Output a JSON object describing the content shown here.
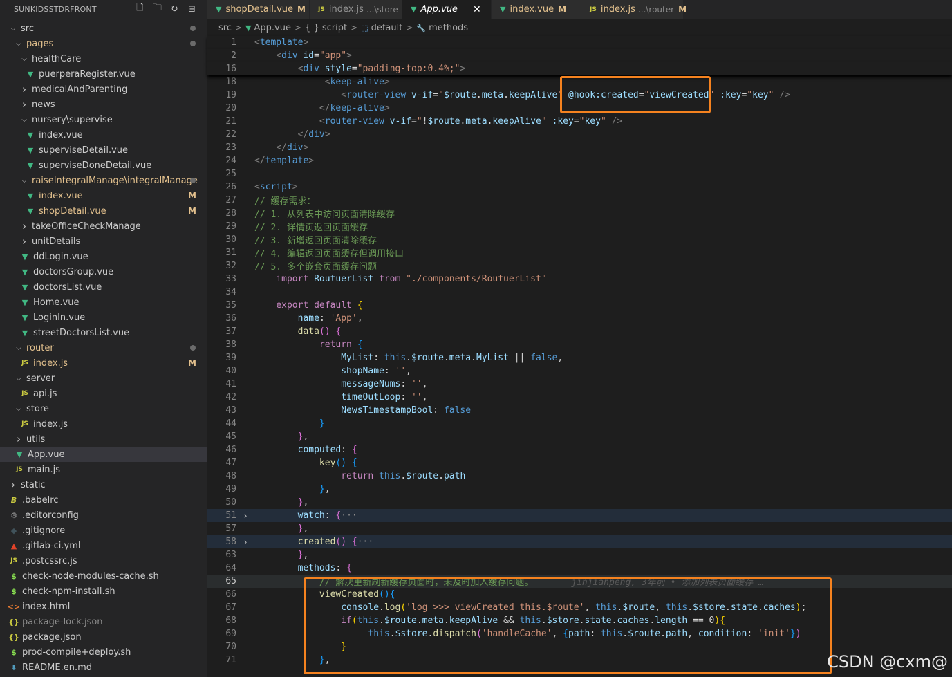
{
  "sidebar": {
    "title": "SUNKIDSSTDRFRONT",
    "actions": [
      "new-file-icon",
      "new-folder-icon",
      "refresh-icon",
      "collapse-all-icon"
    ],
    "items": [
      {
        "label": "src",
        "indent": 0,
        "type": "folder-open",
        "status": "dot"
      },
      {
        "label": "pages",
        "indent": 1,
        "type": "folder-open",
        "status": "dot",
        "color": "mod"
      },
      {
        "label": "healthCare",
        "indent": 2,
        "type": "folder-open"
      },
      {
        "label": "puerperaRegister.vue",
        "indent": 3,
        "type": "vue"
      },
      {
        "label": "medicalAndParenting",
        "indent": 2,
        "type": "folder-closed"
      },
      {
        "label": "news",
        "indent": 2,
        "type": "folder-closed"
      },
      {
        "label": "nursery\\supervise",
        "indent": 2,
        "type": "folder-open"
      },
      {
        "label": "index.vue",
        "indent": 3,
        "type": "vue"
      },
      {
        "label": "superviseDetail.vue",
        "indent": 3,
        "type": "vue"
      },
      {
        "label": "superviseDoneDetail.vue",
        "indent": 3,
        "type": "vue"
      },
      {
        "label": "raiseIntegralManage\\integralManage",
        "indent": 2,
        "type": "folder-open",
        "status": "dot",
        "color": "mod"
      },
      {
        "label": "index.vue",
        "indent": 3,
        "type": "vue",
        "status": "M",
        "color": "mod"
      },
      {
        "label": "shopDetail.vue",
        "indent": 3,
        "type": "vue",
        "status": "M",
        "color": "mod"
      },
      {
        "label": "takeOfficeCheckManage",
        "indent": 2,
        "type": "folder-closed"
      },
      {
        "label": "unitDetails",
        "indent": 2,
        "type": "folder-closed"
      },
      {
        "label": "ddLogin.vue",
        "indent": 2,
        "type": "vue"
      },
      {
        "label": "doctorsGroup.vue",
        "indent": 2,
        "type": "vue"
      },
      {
        "label": "doctorsList.vue",
        "indent": 2,
        "type": "vue"
      },
      {
        "label": "Home.vue",
        "indent": 2,
        "type": "vue"
      },
      {
        "label": "LoginIn.vue",
        "indent": 2,
        "type": "vue"
      },
      {
        "label": "streetDoctorsList.vue",
        "indent": 2,
        "type": "vue"
      },
      {
        "label": "router",
        "indent": 1,
        "type": "folder-open",
        "status": "dot",
        "color": "mod"
      },
      {
        "label": "index.js",
        "indent": 2,
        "type": "js",
        "status": "M",
        "color": "mod"
      },
      {
        "label": "server",
        "indent": 1,
        "type": "folder-open"
      },
      {
        "label": "api.js",
        "indent": 2,
        "type": "js"
      },
      {
        "label": "store",
        "indent": 1,
        "type": "folder-open"
      },
      {
        "label": "index.js",
        "indent": 2,
        "type": "js"
      },
      {
        "label": "utils",
        "indent": 1,
        "type": "folder-closed"
      },
      {
        "label": "App.vue",
        "indent": 1,
        "type": "vue",
        "active": true
      },
      {
        "label": "main.js",
        "indent": 1,
        "type": "js"
      },
      {
        "label": "static",
        "indent": 0,
        "type": "folder-closed"
      },
      {
        "label": ".babelrc",
        "indent": 0,
        "type": "babel"
      },
      {
        "label": ".editorconfig",
        "indent": 0,
        "type": "gear"
      },
      {
        "label": ".gitignore",
        "indent": 0,
        "type": "git"
      },
      {
        "label": ".gitlab-ci.yml",
        "indent": 0,
        "type": "gitlab"
      },
      {
        "label": ".postcssrc.js",
        "indent": 0,
        "type": "js"
      },
      {
        "label": "check-node-modules-cache.sh",
        "indent": 0,
        "type": "sh"
      },
      {
        "label": "check-npm-install.sh",
        "indent": 0,
        "type": "sh"
      },
      {
        "label": "index.html",
        "indent": 0,
        "type": "html"
      },
      {
        "label": "package-lock.json",
        "indent": 0,
        "type": "json",
        "color": "dim"
      },
      {
        "label": "package.json",
        "indent": 0,
        "type": "json"
      },
      {
        "label": "prod-compile+deploy.sh",
        "indent": 0,
        "type": "sh"
      },
      {
        "label": "README.en.md",
        "indent": 0,
        "type": "md"
      }
    ]
  },
  "tabs": [
    {
      "icon": "vue",
      "label": "shopDetail.vue",
      "status": "M"
    },
    {
      "icon": "js",
      "label": "index.js",
      "desc": "...\\store"
    },
    {
      "icon": "vue",
      "label": "App.vue",
      "active": true
    },
    {
      "icon": "vue",
      "label": "index.vue",
      "status": "M"
    },
    {
      "icon": "js",
      "label": "index.js",
      "desc": "...\\router",
      "status": "M"
    }
  ],
  "breadcrumb": [
    "src",
    "App.vue",
    "{ } script",
    "default",
    "methods"
  ],
  "code_lines": [
    {
      "n": "1",
      "sticky": true
    },
    {
      "n": "2",
      "sticky": true
    },
    {
      "n": "16",
      "sticky": true
    },
    {
      "n": "18"
    },
    {
      "n": "19"
    },
    {
      "n": "20"
    },
    {
      "n": "21"
    },
    {
      "n": "22"
    },
    {
      "n": "23"
    },
    {
      "n": "24"
    },
    {
      "n": "25"
    },
    {
      "n": "26"
    },
    {
      "n": "27"
    },
    {
      "n": "28"
    },
    {
      "n": "29"
    },
    {
      "n": "30"
    },
    {
      "n": "31"
    },
    {
      "n": "32"
    },
    {
      "n": "33"
    },
    {
      "n": "34"
    },
    {
      "n": "35"
    },
    {
      "n": "36"
    },
    {
      "n": "37"
    },
    {
      "n": "38"
    },
    {
      "n": "39"
    },
    {
      "n": "40"
    },
    {
      "n": "41"
    },
    {
      "n": "42"
    },
    {
      "n": "43"
    },
    {
      "n": "44"
    },
    {
      "n": "45"
    },
    {
      "n": "46"
    },
    {
      "n": "47"
    },
    {
      "n": "48"
    },
    {
      "n": "49"
    },
    {
      "n": "50"
    },
    {
      "n": "51",
      "fold": true
    },
    {
      "n": "57"
    },
    {
      "n": "58",
      "fold": true
    },
    {
      "n": "63"
    },
    {
      "n": "64"
    },
    {
      "n": "65",
      "current": true
    },
    {
      "n": "66"
    },
    {
      "n": "67"
    },
    {
      "n": "68"
    },
    {
      "n": "69"
    },
    {
      "n": "70"
    },
    {
      "n": "71"
    }
  ],
  "git_blame": "jinjianpeng, 3年前 • 添加列表页面缓存 …",
  "watermark": "CSDN @cxm@",
  "colors": {
    "highlight_box": "#f5821f",
    "modified": "#e2c08d",
    "vue": "#41b883"
  }
}
